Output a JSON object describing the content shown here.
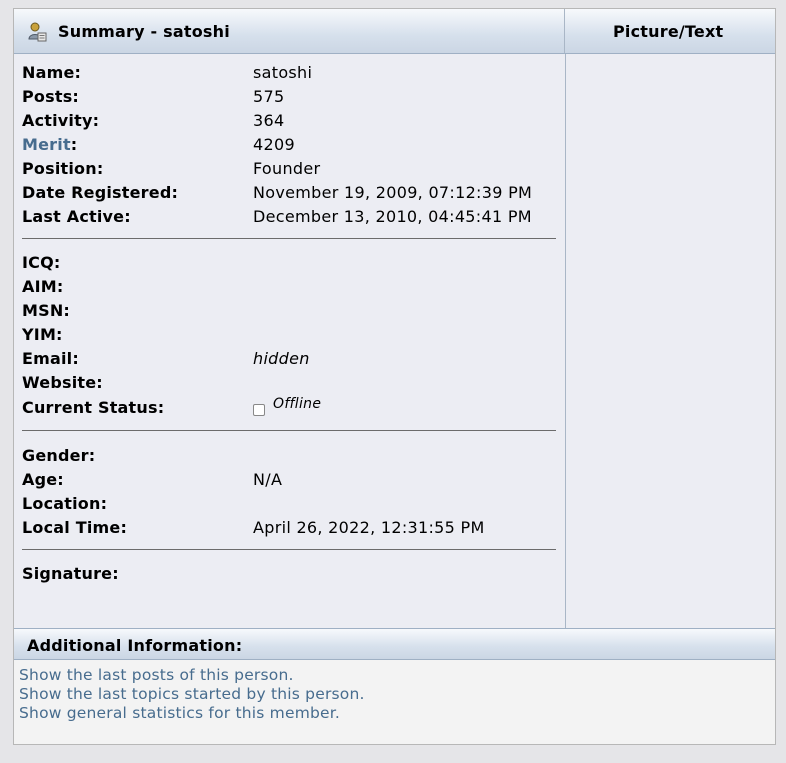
{
  "summary": {
    "title": "Summary - satoshi",
    "picture_title": "Picture/Text"
  },
  "profile": {
    "name_label": "Name:",
    "name": "satoshi",
    "posts_label": "Posts:",
    "posts": "575",
    "activity_label": "Activity:",
    "activity": "364",
    "merit_label": "Merit",
    "merit_colon": ":",
    "merit": "4209",
    "position_label": "Position:",
    "position": "Founder",
    "registered_label": "Date Registered:",
    "registered": "November 19, 2009, 07:12:39 PM",
    "last_active_label": "Last Active:",
    "last_active": "December 13, 2010, 04:45:41 PM"
  },
  "contact": {
    "icq_label": "ICQ:",
    "aim_label": "AIM:",
    "msn_label": "MSN:",
    "yim_label": "YIM:",
    "email_label": "Email:",
    "email": "hidden",
    "website_label": "Website:",
    "status_label": "Current Status:",
    "status": "Offline"
  },
  "personal": {
    "gender_label": "Gender:",
    "age_label": "Age:",
    "age": "N/A",
    "location_label": "Location:",
    "local_time_label": "Local Time:",
    "local_time": "April 26, 2022, 12:31:55 PM"
  },
  "signature": {
    "label": "Signature:"
  },
  "additional": {
    "title": "Additional Information:",
    "links": [
      "Show the last posts of this person.",
      "Show the last topics started by this person.",
      "Show general statistics for this member."
    ]
  },
  "colors": {
    "link": "#476c8e",
    "header_gradient_end": "#cbd6e4",
    "panel": "#ecedf3"
  },
  "icons": {
    "title_icon": "user-profile-icon",
    "status_icon": "offline-status-icon"
  }
}
